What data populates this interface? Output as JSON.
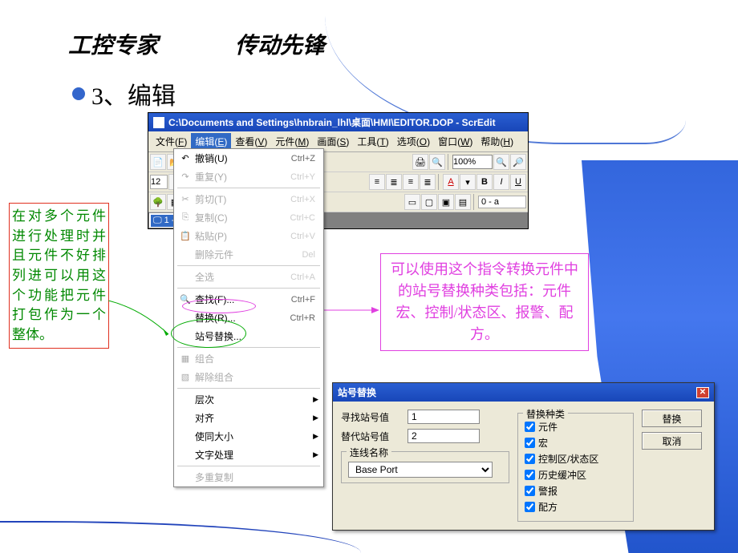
{
  "header": {
    "left": "工控专家",
    "right": "传动先锋"
  },
  "bullet": {
    "text": "3、编辑"
  },
  "note_left": "在对多个元件进行处理时并且元件不好排列进可以用这个功能把元件打包作为一个整体。",
  "note_right": "可以使用这个指令转换元件中的站号替换种类包括：元件宏、控制/状态区、报警、配方。",
  "app": {
    "title": "C:\\Documents and Settings\\hnbrain_lhl\\桌面\\HMI\\EDITOR.DOP - ScrEdit",
    "menubar": [
      {
        "label": "文件(F)",
        "key": "file"
      },
      {
        "label": "编辑(E)",
        "key": "edit",
        "active": true
      },
      {
        "label": "查看(V)",
        "key": "view"
      },
      {
        "label": "元件(M)",
        "key": "element"
      },
      {
        "label": "画面(S)",
        "key": "screen"
      },
      {
        "label": "工具(T)",
        "key": "tool"
      },
      {
        "label": "选项(O)",
        "key": "option"
      },
      {
        "label": "窗口(W)",
        "key": "window"
      },
      {
        "label": "帮助(H)",
        "key": "help"
      }
    ],
    "zoom": "100%",
    "font_size": "12",
    "text_sample": "0 - a",
    "tree_item": "1 -"
  },
  "dropdown": {
    "items": [
      {
        "icon": "undo",
        "label": "撤销(U)",
        "shortcut": "Ctrl+Z",
        "enabled": true
      },
      {
        "icon": "redo",
        "label": "重复(Y)",
        "shortcut": "Ctrl+Y",
        "enabled": false
      },
      {
        "sep": true
      },
      {
        "icon": "cut",
        "label": "剪切(T)",
        "shortcut": "Ctrl+X",
        "enabled": false
      },
      {
        "icon": "copy",
        "label": "复制(C)",
        "shortcut": "Ctrl+C",
        "enabled": false
      },
      {
        "icon": "paste",
        "label": "粘贴(P)",
        "shortcut": "Ctrl+V",
        "enabled": false
      },
      {
        "icon": "",
        "label": "删除元件",
        "shortcut": "Del",
        "enabled": false
      },
      {
        "sep": true
      },
      {
        "icon": "",
        "label": "全选",
        "shortcut": "Ctrl+A",
        "enabled": false
      },
      {
        "sep": true
      },
      {
        "icon": "find",
        "label": "查找(F)...",
        "shortcut": "Ctrl+F",
        "enabled": true
      },
      {
        "icon": "",
        "label": "替换(R)...",
        "shortcut": "Ctrl+R",
        "enabled": true
      },
      {
        "icon": "",
        "label": "站号替换...",
        "shortcut": "",
        "enabled": true
      },
      {
        "sep": true
      },
      {
        "icon": "group",
        "label": "组合",
        "shortcut": "",
        "enabled": false
      },
      {
        "icon": "ungroup",
        "label": "解除组合",
        "shortcut": "",
        "enabled": false
      },
      {
        "sep": true
      },
      {
        "icon": "",
        "label": "层次",
        "sub": true,
        "enabled": true
      },
      {
        "icon": "",
        "label": "对齐",
        "sub": true,
        "enabled": true
      },
      {
        "icon": "",
        "label": "使同大小",
        "sub": true,
        "enabled": true
      },
      {
        "icon": "",
        "label": "文字处理",
        "sub": true,
        "enabled": true
      },
      {
        "sep": true
      },
      {
        "icon": "",
        "label": "多重复制",
        "shortcut": "",
        "enabled": false
      }
    ]
  },
  "dialog": {
    "title": "站号替换",
    "find_label": "寻找站号值",
    "find_value": "1",
    "replace_label": "替代站号值",
    "replace_value": "2",
    "port_group": "连线名称",
    "port_value": "Base Port",
    "type_group": "替换种类",
    "checks": [
      {
        "label": "元件",
        "checked": true
      },
      {
        "label": "宏",
        "checked": true
      },
      {
        "label": "控制区/状态区",
        "checked": true
      },
      {
        "label": "历史缓冲区",
        "checked": true
      },
      {
        "label": "警报",
        "checked": true
      },
      {
        "label": "配方",
        "checked": true
      }
    ],
    "btn_replace": "替换",
    "btn_cancel": "取消"
  }
}
